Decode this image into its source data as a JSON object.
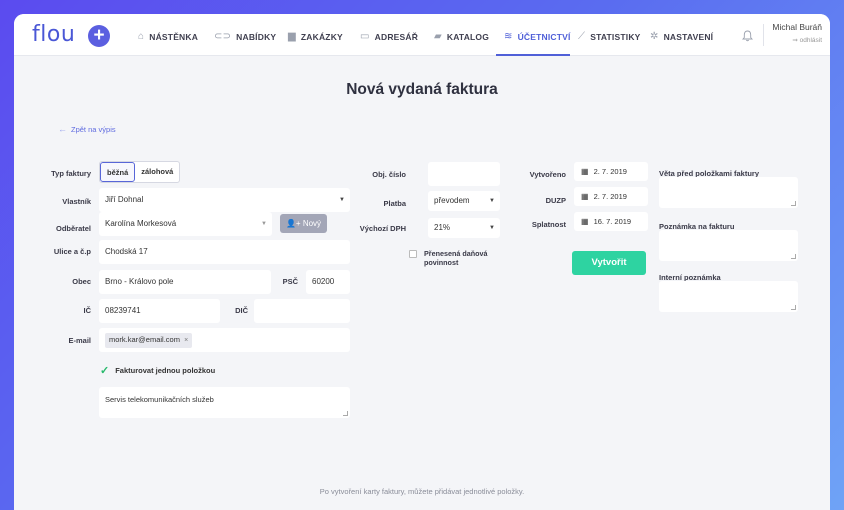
{
  "nav": {
    "logo": "flou",
    "plus_icon": "plus",
    "items": [
      {
        "label": "NÁSTĚNKA",
        "icon": "home-icon",
        "glyph": "⌂"
      },
      {
        "label": "NABÍDKY",
        "icon": "handshake-icon",
        "glyph": "⊂⊃"
      },
      {
        "label": "ZAKÁZKY",
        "icon": "briefcase-icon",
        "glyph": "▆"
      },
      {
        "label": "ADRESÁŘ",
        "icon": "contact-card-icon",
        "glyph": "▭"
      },
      {
        "label": "KATALOG",
        "icon": "folder-icon",
        "glyph": "▰"
      },
      {
        "label": "ÚČETNICTVÍ",
        "icon": "coins-icon",
        "glyph": "≋",
        "active": true
      },
      {
        "label": "STATISTIKY",
        "icon": "chart-icon",
        "glyph": "⟋"
      },
      {
        "label": "NASTAVENÍ",
        "icon": "gears-icon",
        "glyph": "✲"
      }
    ],
    "bell_icon": "bell-icon",
    "user_name": "Michal Buráň",
    "logout": "⇒ odhlásit"
  },
  "page": {
    "title": "Nová vydaná faktura",
    "back_link": "Zpět na výpis"
  },
  "form": {
    "typ_faktury": {
      "label": "Typ faktury",
      "options": [
        "běžná",
        "zálohová"
      ],
      "selected": "běžná"
    },
    "vlastnik": {
      "label": "Vlastník",
      "value": "Jiří Dohnal"
    },
    "odberatel": {
      "label": "Odběratel",
      "value": "Karolína Morkesová",
      "new_button": "Nový"
    },
    "ulice": {
      "label": "Ulice a č.p",
      "value": "Chodská 17"
    },
    "obec": {
      "label": "Obec",
      "value": "Brno - Královo pole"
    },
    "psc": {
      "label": "PSČ",
      "value": "60200"
    },
    "ic": {
      "label": "IČ",
      "value": "08239741"
    },
    "dic": {
      "label": "DIČ",
      "value": ""
    },
    "email": {
      "label": "E-mail",
      "tag": "mork.kar@email.com",
      "tag_remove": "×"
    },
    "single_item": {
      "label": "Fakturovat jednou položkou",
      "checked": true
    },
    "item_text": "Servis telekomunikačních služeb",
    "obj_cislo": {
      "label": "Obj. číslo",
      "value": ""
    },
    "platba": {
      "label": "Platba",
      "value": "převodem"
    },
    "dph": {
      "label": "Výchozí DPH",
      "value": "21%"
    },
    "prenesena": {
      "label": "Přenesená daňová povinnost",
      "checked": false
    },
    "vytvoreno": {
      "label": "Vytvořeno",
      "value": "2. 7. 2019"
    },
    "duzp": {
      "label": "DUZP",
      "value": "2. 7. 2019"
    },
    "splatnost": {
      "label": "Splatnost",
      "value": "16. 7. 2019"
    },
    "create_button": "Vytvořit",
    "veta_pred": {
      "label": "Věta před položkami faktury",
      "value": ""
    },
    "poznamka": {
      "label": "Poznámka na fakturu",
      "value": ""
    },
    "interni": {
      "label": "Interní poznámka",
      "value": ""
    }
  },
  "footer_note": "Po vytvoření karty faktury, můžete přidávat jednotlivé položky.",
  "colors": {
    "accent": "#5060d8",
    "create_button": "#2ed3a1",
    "check": "#27b96b"
  }
}
